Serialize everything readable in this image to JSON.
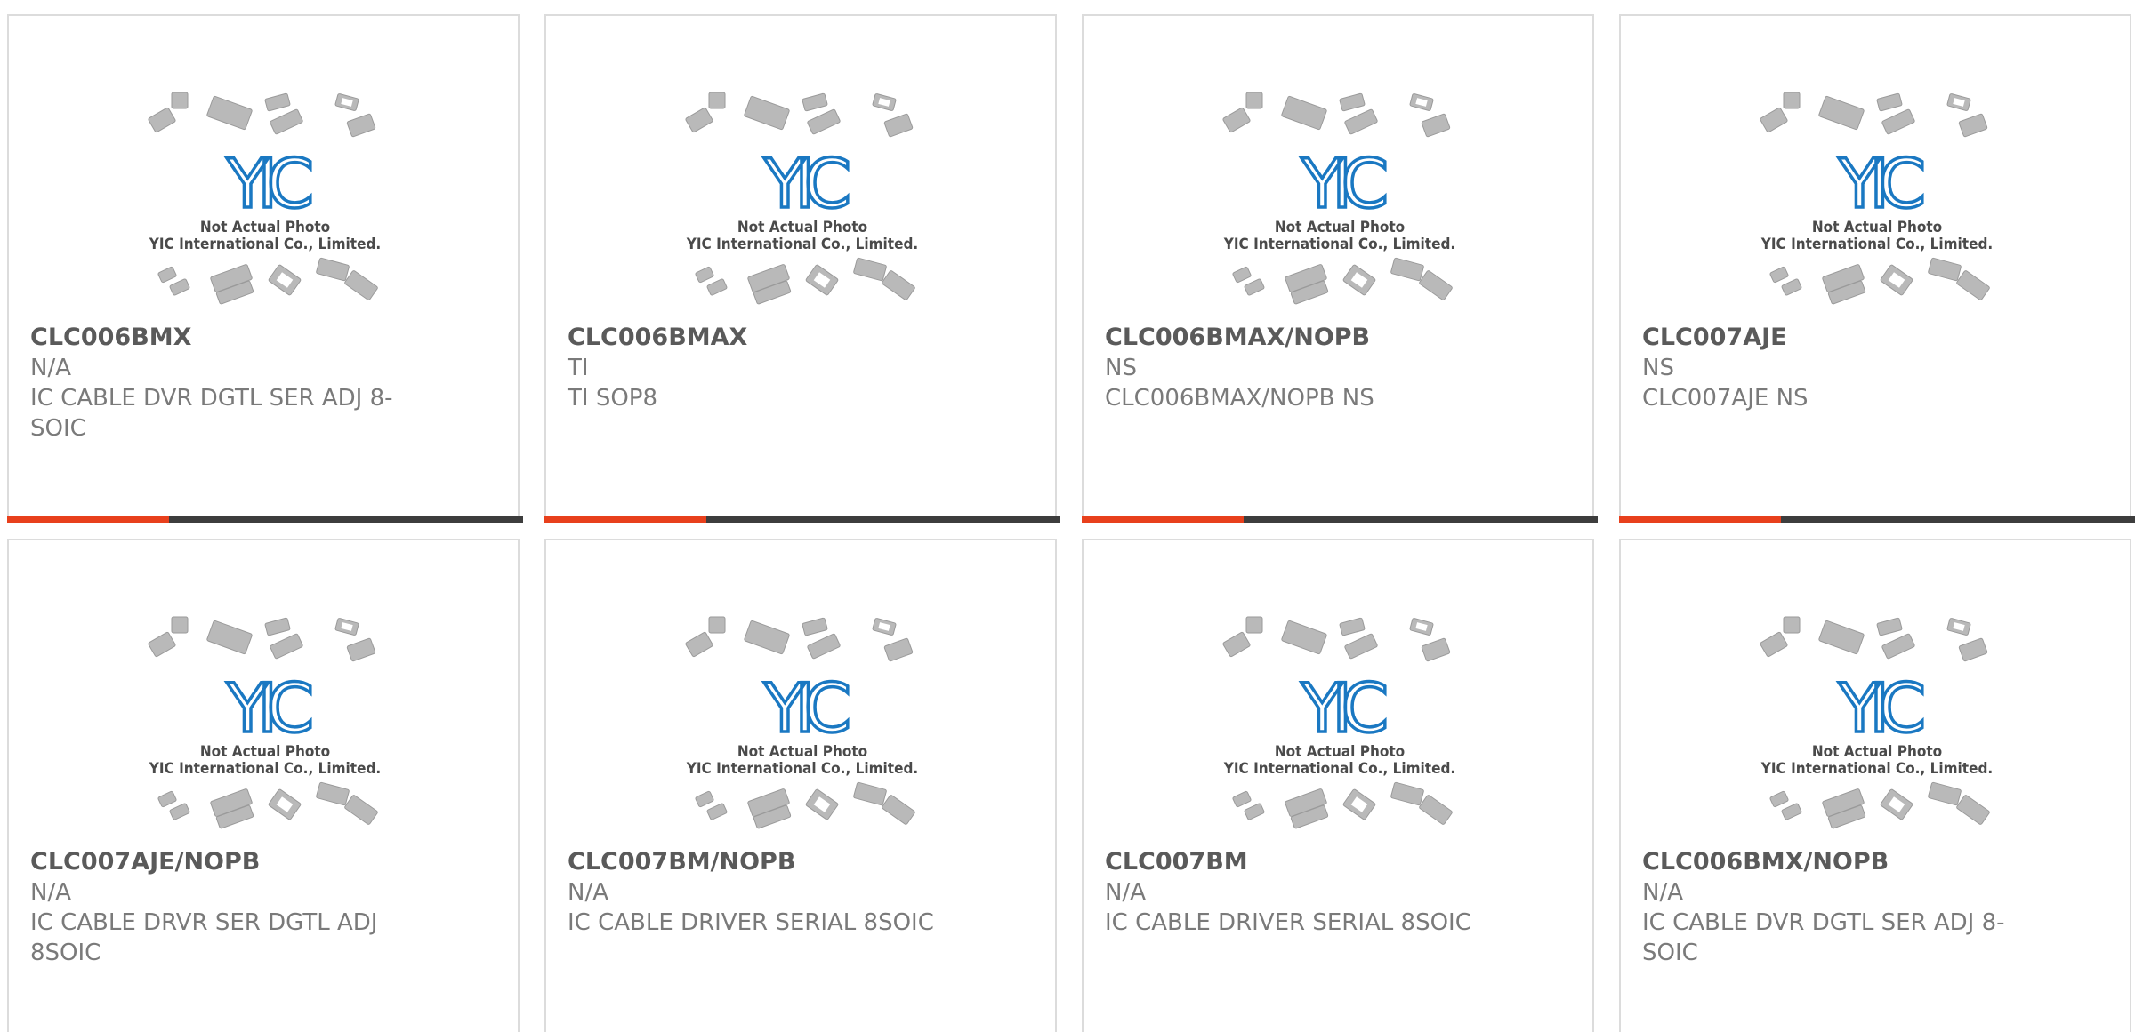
{
  "placeholder": {
    "line1": "Not Actual Photo",
    "line2": "YIC International Co., Limited.",
    "logo_text": "YIC",
    "colors": {
      "logo": "#1a78c2",
      "chips": "#b9b9b9",
      "text": "#4a4a4a",
      "accent": "#e8401c",
      "bar": "#3d3d3d"
    }
  },
  "products": [
    {
      "part_number": "CLC006BMX",
      "manufacturer": "N/A",
      "description": "IC CABLE DVR DGTL SER ADJ 8-SOIC"
    },
    {
      "part_number": "CLC006BMAX",
      "manufacturer": "TI",
      "description": "TI SOP8"
    },
    {
      "part_number": "CLC006BMAX/NOPB",
      "manufacturer": "NS",
      "description": "CLC006BMAX/NOPB NS"
    },
    {
      "part_number": "CLC007AJE",
      "manufacturer": "NS",
      "description": "CLC007AJE NS"
    },
    {
      "part_number": "CLC007AJE/NOPB",
      "manufacturer": "N/A",
      "description": "IC CABLE DRVR SER DGTL ADJ 8SOIC"
    },
    {
      "part_number": "CLC007BM/NOPB",
      "manufacturer": "N/A",
      "description": "IC CABLE DRIVER SERIAL 8SOIC"
    },
    {
      "part_number": "CLC007BM",
      "manufacturer": "N/A",
      "description": "IC CABLE DRIVER SERIAL 8SOIC"
    },
    {
      "part_number": "CLC006BMX/NOPB",
      "manufacturer": "N/A",
      "description": "IC CABLE DVR DGTL SER ADJ 8-SOIC"
    }
  ]
}
